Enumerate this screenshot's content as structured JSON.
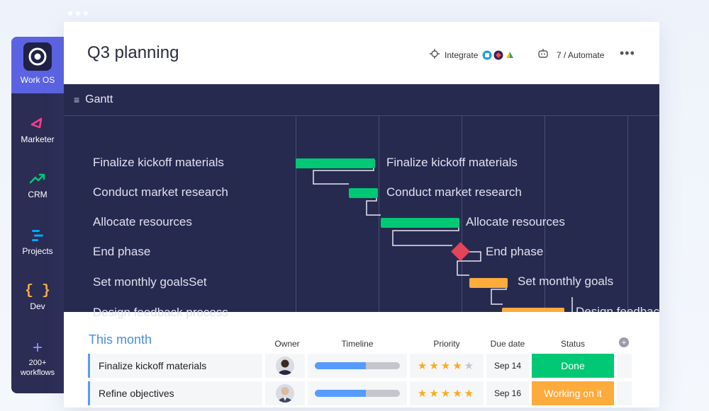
{
  "sidebar": {
    "items": [
      {
        "label": "Work OS",
        "icon": "workos-logo-icon"
      },
      {
        "label": "Marketer",
        "icon": "megaphone-icon"
      },
      {
        "label": "CRM",
        "icon": "trend-up-icon"
      },
      {
        "label": "Projects",
        "icon": "bars-icon"
      },
      {
        "label": "Dev",
        "icon": "braces-icon"
      },
      {
        "label": "200+ workflows",
        "icon": "plus-icon"
      }
    ]
  },
  "header": {
    "title": "Q3 planning",
    "integrate_label": "Integrate",
    "automate_label": "7 / Automate"
  },
  "gantt": {
    "title": "Gantt",
    "tasks": [
      {
        "name": "Finalize kickoff materials",
        "bar_label": "Finalize kickoff materials",
        "type": "bar",
        "color": "#00c875"
      },
      {
        "name": "Conduct market research",
        "bar_label": "Conduct market research",
        "type": "bar",
        "color": "#00c875"
      },
      {
        "name": "Allocate resources",
        "bar_label": "Allocate resources",
        "type": "bar",
        "color": "#00c875"
      },
      {
        "name": "End phase",
        "bar_label": "End phase",
        "type": "milestone",
        "color": "#e2445c"
      },
      {
        "name": "Set monthly goalsSet",
        "bar_label": "Set monthly goals",
        "type": "bar",
        "color": "#fdab3d"
      },
      {
        "name": "Design feedback process",
        "bar_label": "Design feedbac",
        "type": "bar",
        "color": "#fdab3d"
      }
    ]
  },
  "board": {
    "group_title": "This month",
    "columns": {
      "owner": "Owner",
      "timeline": "Timeline",
      "priority": "Priority",
      "due": "Due date",
      "status": "Status"
    },
    "rows": [
      {
        "name": "Finalize kickoff materials",
        "timeline_progress": 0.6,
        "priority_stars": 4,
        "due": "Sep 14",
        "status": "Done",
        "status_color": "#00c875"
      },
      {
        "name": "Refine objectives",
        "timeline_progress": 0.6,
        "priority_stars": 5,
        "due": "Sep 16",
        "status": "Working on it",
        "status_color": "#fdab3d"
      }
    ]
  }
}
